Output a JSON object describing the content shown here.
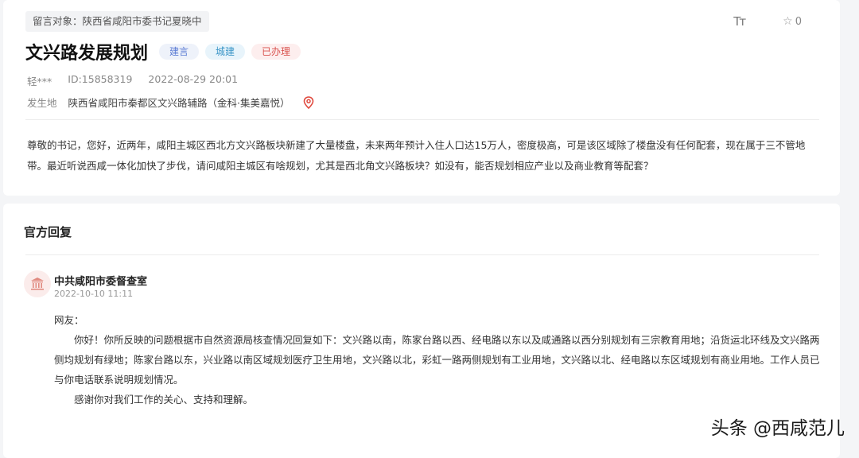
{
  "message": {
    "target": "留言对象：陕西省咸阳市委书记夏晓中",
    "title": "文兴路发展规划",
    "tags": {
      "type": "建言",
      "category": "城建",
      "status": "已办理"
    },
    "author": "轻***",
    "id": "ID:15858319",
    "datetime": "2022-08-29 20:01",
    "location_label": "发生地",
    "location_value": "陕西省咸阳市秦都区文兴路辅路（金科·集美嘉悦）",
    "content": "尊敬的书记，您好，近两年，咸阳主城区西北方文兴路板块新建了大量楼盘，未来两年预计入住人口达15万人，密度极高，可是该区域除了楼盘没有任何配套，现在属于三不管地带。最近听说西咸一体化加快了步伐，请问咸阳主城区有啥规划，尤其是西北角文兴路板块？如没有，能否规划相应产业以及商业教育等配套？"
  },
  "toolbar": {
    "font_label": "Tт",
    "favorite_count": "0"
  },
  "reply": {
    "heading": "官方回复",
    "department": "中共咸阳市委督查室",
    "datetime": "2022-10-10 11:11",
    "greeting": "网友：",
    "body": "你好！你所反映的问题根据市自然资源局核查情况回复如下：文兴路以南，陈家台路以西、经电路以东以及咸通路以西分别规划有三宗教育用地；沿货运北环线及文兴路两侧均规划有绿地；陈家台路以东，兴业路以南区域规划医疗卫生用地，文兴路以北，彩虹一路两侧规划有工业用地，文兴路以北、经电路以东区域规划有商业用地。工作人员已与你电话联系说明规划情况。",
    "closing": "感谢你对我们工作的关心、支持和理解。"
  },
  "watermark": "头条 @西咸范儿",
  "colors": {
    "status_red": "#d9534f",
    "pin_red": "#e04a3f",
    "type_blue": "#5a7bd4",
    "category_blue": "#3a95c7"
  },
  "icons": {
    "font_size": "font-size-icon",
    "favorite": "star-icon",
    "location": "location-pin-icon",
    "department": "government-building-icon"
  }
}
